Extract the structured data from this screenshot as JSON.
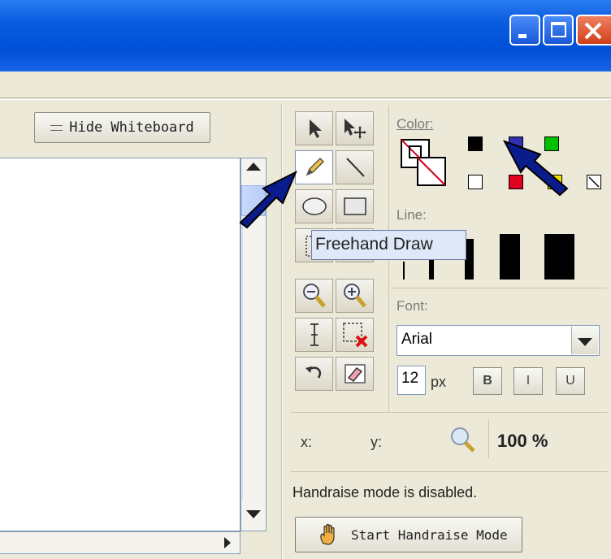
{
  "window": {
    "min_icon": "minimize-icon",
    "max_icon": "maximize-icon",
    "close_icon": "close-icon"
  },
  "whiteboard": {
    "hide_button_label": "Hide Whiteboard"
  },
  "tools": [
    {
      "name": "select-tool",
      "icon": "arrow-cursor-icon"
    },
    {
      "name": "move-tool",
      "icon": "move-cursor-icon"
    },
    {
      "name": "freehand-tool",
      "icon": "pencil-icon"
    },
    {
      "name": "line-tool",
      "icon": "line-icon"
    },
    {
      "name": "ellipse-tool",
      "icon": "ellipse-icon"
    },
    {
      "name": "rectangle-tool",
      "icon": "rectangle-icon"
    },
    {
      "name": "select-area-tool",
      "icon": "dotted-rect-icon"
    },
    {
      "name": "filled-rect-tool",
      "icon": "filled-rect-icon"
    },
    {
      "name": "zoom-out-tool",
      "icon": "zoom-out-icon"
    },
    {
      "name": "zoom-in-tool",
      "icon": "zoom-in-icon"
    },
    {
      "name": "text-tool",
      "icon": "text-cursor-icon"
    },
    {
      "name": "delete-selection-tool",
      "icon": "delete-selection-icon"
    },
    {
      "name": "undo-tool",
      "icon": "undo-icon"
    },
    {
      "name": "eraser-tool",
      "icon": "eraser-icon"
    }
  ],
  "tooltip": "Freehand Draw",
  "color": {
    "label": "Color:",
    "swatches": [
      "#000000",
      "#3030b0",
      "#00c000",
      "#ffffff",
      "#e00020",
      "#f0e000"
    ],
    "fg_color": "#000000",
    "bg_color": "#ffffff"
  },
  "line": {
    "label": "Line:"
  },
  "font": {
    "label": "Font:",
    "value": "Arial",
    "size": "12",
    "size_unit": "px",
    "bold_label": "B",
    "italic_label": "I",
    "underline_label": "U"
  },
  "coords": {
    "x_label": "x:",
    "y_label": "y:",
    "zoom": "100 %"
  },
  "handraise": {
    "status": "Handraise mode is disabled.",
    "button_label": "Start Handraise Mode"
  },
  "annotations": {
    "arrow_color": "#0a1c8c"
  }
}
